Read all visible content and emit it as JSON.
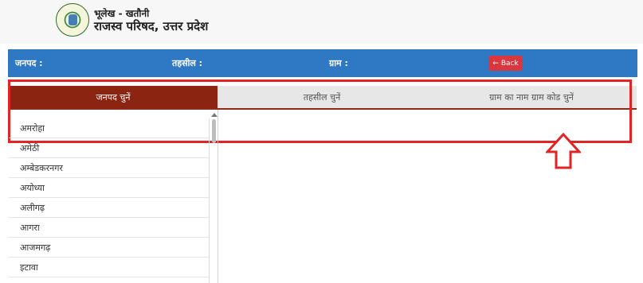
{
  "header": {
    "title_top": "भूलेख - खतौनी",
    "title_main": "राजस्व परिषद, उत्तर प्रदेश",
    "logo_icon": "emblem-seal-icon"
  },
  "filter_bar": {
    "janpad_label": "जनपद :",
    "tehsil_label": "तहसील :",
    "gram_label": "ग्राम :",
    "back_label": "Back",
    "back_icon": "arrow-left-icon",
    "bar_color": "#2f78c4",
    "back_color": "#d9373d"
  },
  "tabs": [
    {
      "label": "जनपद चुनें",
      "active": true
    },
    {
      "label": "तहसील चुनें",
      "active": false
    },
    {
      "label": "ग्राम का नाम ग्राम कोड चुनें",
      "active": false
    }
  ],
  "active_tab_color": "#8b2410",
  "districts": [
    "अमरोहा",
    "अमेठी",
    "अम्बेडकरनगर",
    "अयोध्या",
    "अलीगढ़",
    "आगरा",
    "आजमगढ़",
    "इटावा"
  ],
  "annotation": {
    "highlight_color": "#e32424",
    "arrow_icon": "up-arrow-outline-icon"
  }
}
